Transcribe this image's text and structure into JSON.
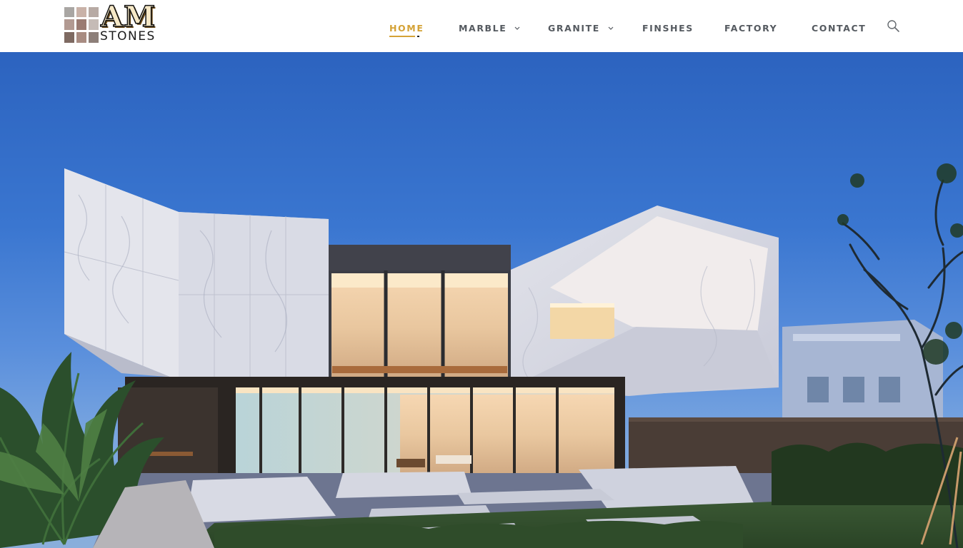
{
  "brand": {
    "logo_primary": "AM",
    "logo_secondary": "STONES",
    "tile_colors": [
      "#a9a6a3",
      "#c9b2a8",
      "#9a7b72",
      "#b29a92",
      "#7e6a62",
      "#c5bbb6",
      "#8d7f79",
      "#a88c82",
      "#b7aaa4"
    ]
  },
  "nav": {
    "items": [
      {
        "label": "HOME",
        "active": true,
        "dropdown": false
      },
      {
        "label": "MARBLE",
        "active": false,
        "dropdown": true
      },
      {
        "label": "GRANITE",
        "active": false,
        "dropdown": true
      },
      {
        "label": "FINSHES",
        "active": false,
        "dropdown": false
      },
      {
        "label": "FACTORY",
        "active": false,
        "dropdown": false
      },
      {
        "label": "CONTACT",
        "active": false,
        "dropdown": false
      }
    ],
    "dropdown_icon": "chevron-down-icon",
    "search_icon": "search-icon",
    "active_color": "#d4a236",
    "text_color": "#555a60"
  },
  "hero": {
    "image_subject": "modern-marble-clad-house-at-dusk",
    "sky_color": "#3a76d0",
    "marble_color": "#dcdde6"
  }
}
